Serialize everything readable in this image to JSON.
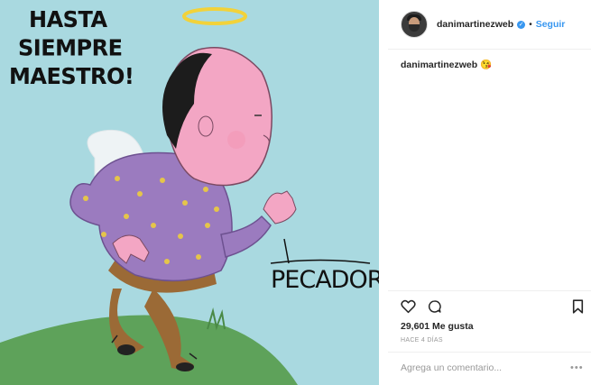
{
  "post": {
    "art_text": {
      "line1": "HASTA",
      "line2": "SIEMPRE",
      "line3": "MAESTRO!",
      "sign": "PECADOR"
    },
    "author": {
      "username": "danimartinezweb",
      "verified": true,
      "follow_label": "Seguir",
      "separator": "•"
    },
    "caption": {
      "username": "danimartinezweb",
      "text": "😘"
    },
    "likes_label": "29,601 Me gusta",
    "time_label": "HACE 4 DÍAS",
    "comment_placeholder": "Agrega un comentario...",
    "more_icon": "more-options-icon",
    "colors": {
      "background_art": "#a9d9e0",
      "link_blue": "#3897f0"
    }
  }
}
